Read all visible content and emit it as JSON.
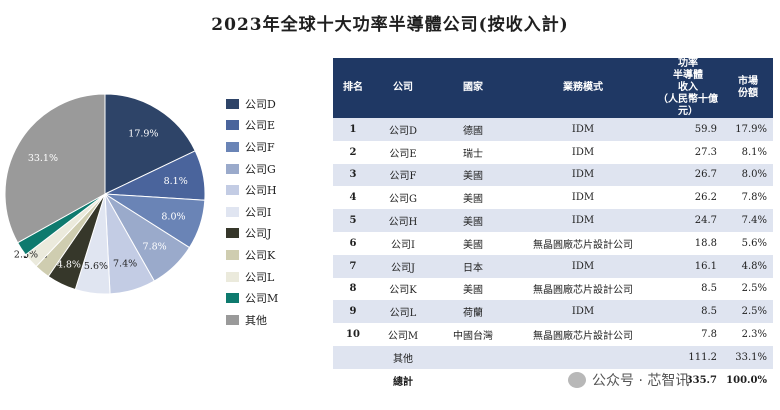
{
  "chart_data": [
    {
      "type": "pie",
      "title": "2023年全球十大功率半導體公司(按收入計)",
      "categories": [
        "公司D",
        "公司E",
        "公司F",
        "公司G",
        "公司H",
        "公司I",
        "公司J",
        "公司K",
        "公司L",
        "公司M",
        "其他"
      ],
      "values": [
        17.9,
        8.1,
        8.0,
        7.8,
        7.4,
        5.6,
        4.8,
        2.5,
        2.5,
        2.3,
        33.1
      ],
      "labels": [
        "17.9%",
        "8.1%",
        "8.0%",
        "7.8%",
        "7.4%",
        "5.6%",
        "4.8%",
        "2.5%",
        "2.5%",
        "2.3%",
        "33.1%"
      ],
      "colors": [
        "#2e4468",
        "#4a649c",
        "#6a84b6",
        "#9aaacb",
        "#c3cce4",
        "#e0e5f1",
        "#36372a",
        "#cfcdb0",
        "#ebeadc",
        "#0e7a6e",
        "#9a9a9a"
      ],
      "legend_placement": "right"
    },
    {
      "type": "table",
      "columns": [
        "排名",
        "公司",
        "國家",
        "業務模式",
        "功率\n半導體\n收入\n（人民幣十億元）",
        "市場\n份額"
      ],
      "rows": [
        [
          "1",
          "公司D",
          "德國",
          "IDM",
          "59.9",
          "17.9%"
        ],
        [
          "2",
          "公司E",
          "瑞士",
          "IDM",
          "27.3",
          "8.1%"
        ],
        [
          "3",
          "公司F",
          "美國",
          "IDM",
          "26.7",
          "8.0%"
        ],
        [
          "4",
          "公司G",
          "美國",
          "IDM",
          "26.2",
          "7.8%"
        ],
        [
          "5",
          "公司H",
          "美國",
          "IDM",
          "24.7",
          "7.4%"
        ],
        [
          "6",
          "公司I",
          "美國",
          "無晶圓廠芯片設計公司",
          "18.8",
          "5.6%"
        ],
        [
          "7",
          "公司J",
          "日本",
          "IDM",
          "16.1",
          "4.8%"
        ],
        [
          "8",
          "公司K",
          "美國",
          "無晶圓廠芯片設計公司",
          "8.5",
          "2.5%"
        ],
        [
          "9",
          "公司L",
          "荷蘭",
          "IDM",
          "8.5",
          "2.5%"
        ],
        [
          "10",
          "公司M",
          "中國台灣",
          "無晶圓廠芯片設計公司",
          "7.8",
          "2.3%"
        ],
        [
          "",
          "其他",
          "",
          "",
          "111.2",
          "33.1%"
        ],
        [
          "",
          "總計",
          "",
          "",
          "335.7",
          "100.0%"
        ]
      ]
    }
  ],
  "watermark": "公众号 · 芯智讯"
}
